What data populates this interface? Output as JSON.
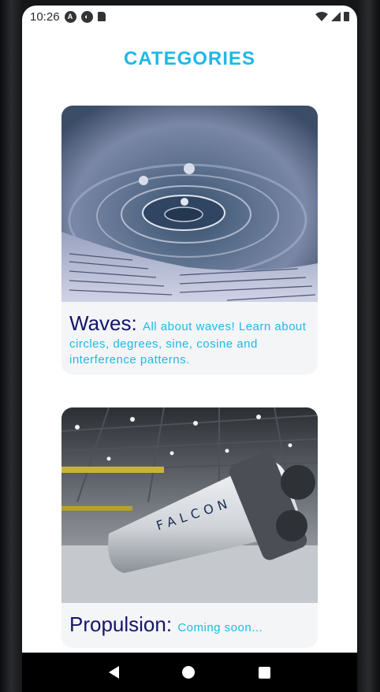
{
  "status_bar": {
    "time": "10:26"
  },
  "page": {
    "title": "CATEGORIES"
  },
  "categories": [
    {
      "title": "Waves:",
      "description": "All about waves! Learn about circles, degrees, sine, cosine and interference patterns."
    },
    {
      "title": "Propulsion:",
      "description": "Coming soon..."
    }
  ],
  "colors": {
    "accent": "#1fb8e6",
    "title_text": "#14166a",
    "card_bg": "#f4f5f7"
  }
}
